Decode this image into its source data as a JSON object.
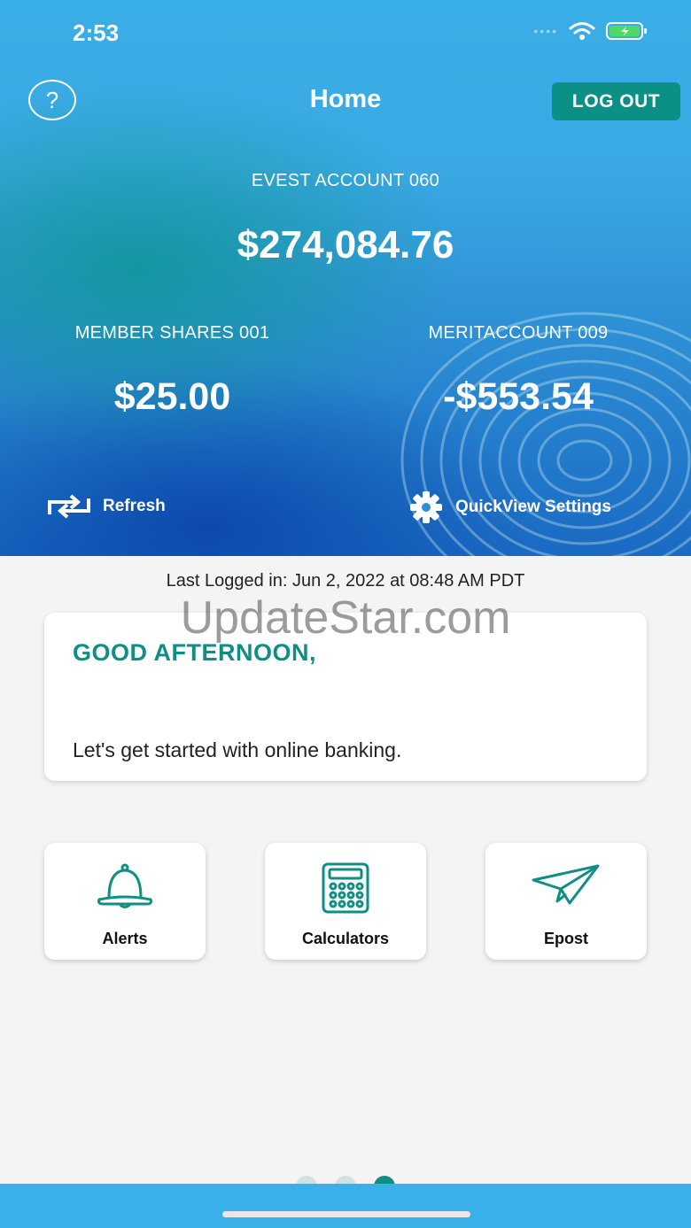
{
  "status_bar": {
    "time": "2:53"
  },
  "header": {
    "title": "Home",
    "help_icon": "?",
    "logout_label": "LOG OUT"
  },
  "accounts": {
    "main": {
      "label": "EVEST ACCOUNT 060",
      "amount": "$274,084.76"
    },
    "left": {
      "label": "MEMBER SHARES 001",
      "amount": "$25.00"
    },
    "right": {
      "label": "MERITACCOUNT 009",
      "amount": "-$553.54"
    }
  },
  "actions": {
    "refresh_label": "Refresh",
    "quickview_label": "QuickView Settings"
  },
  "last_login": "Last Logged in: Jun 2, 2022 at 08:48 AM  PDT",
  "watermark": "UpdateStar.com",
  "greeting": {
    "title": "GOOD AFTERNOON,",
    "text": "Let's get started with online banking."
  },
  "tiles": [
    {
      "label": "Alerts",
      "icon": "bell-icon"
    },
    {
      "label": "Calculators",
      "icon": "calculator-icon"
    },
    {
      "label": "Epost",
      "icon": "paper-plane-icon"
    }
  ],
  "colors": {
    "accent": "#0f8f84",
    "hero_blue": "#3aaee6",
    "background": "#f4f4f4"
  }
}
